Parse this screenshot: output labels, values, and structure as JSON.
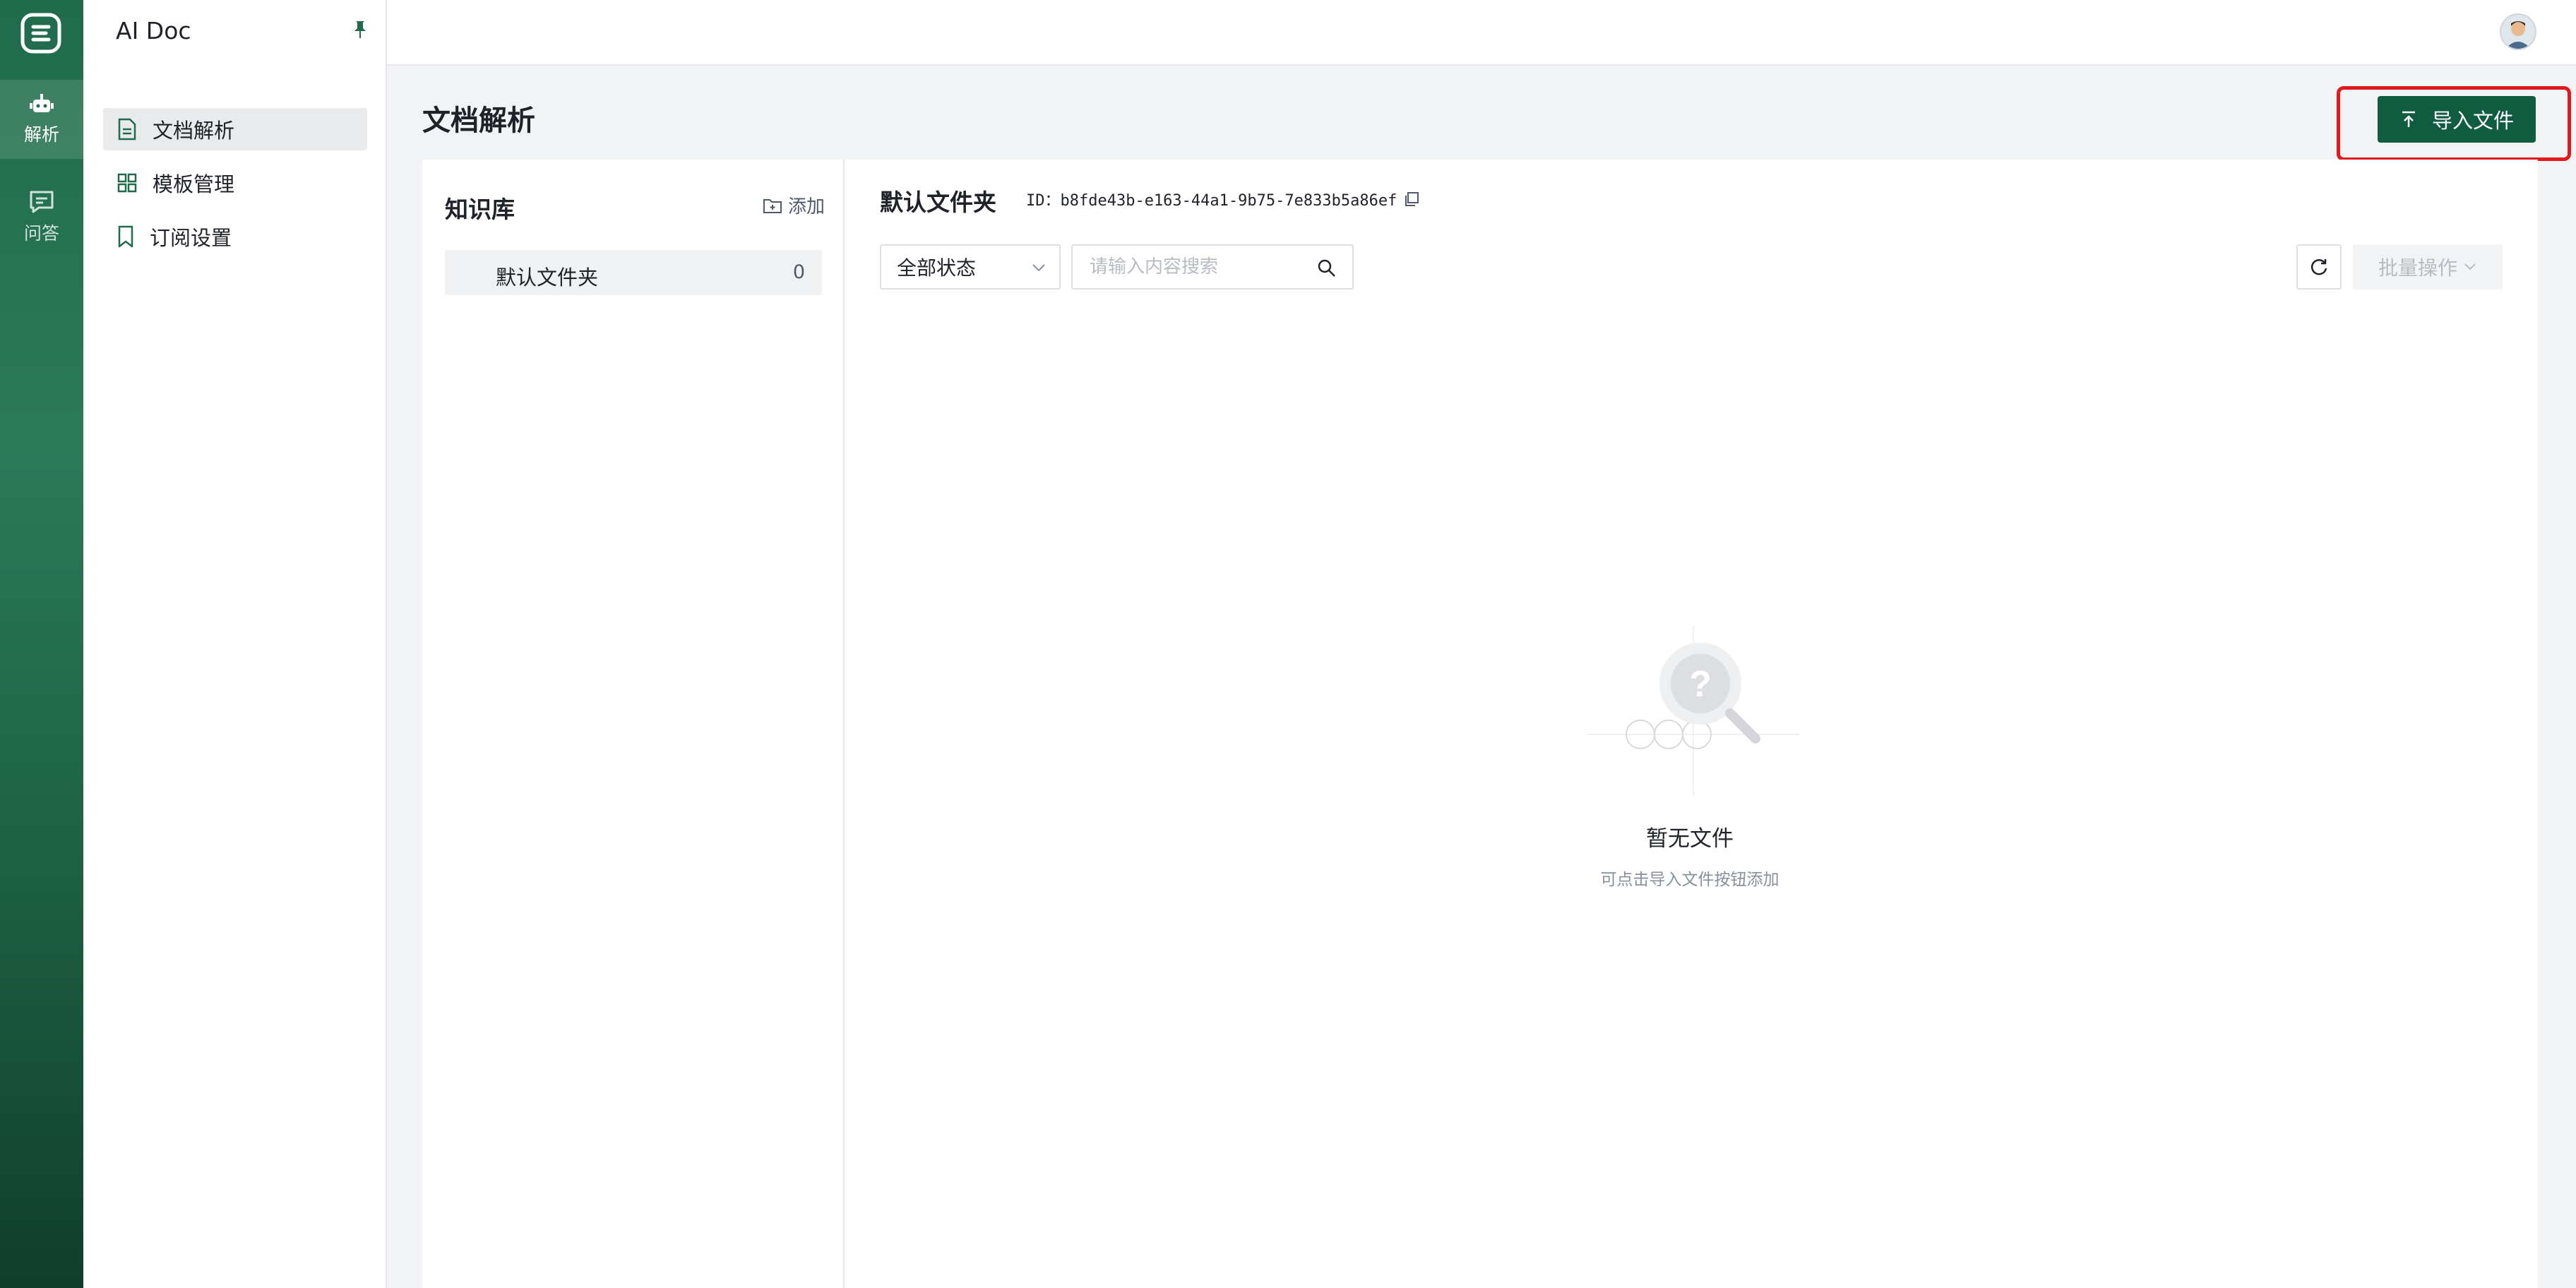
{
  "app": {
    "title": "AI Doc"
  },
  "rail": {
    "items": [
      {
        "label": "解析",
        "icon": "robot-icon",
        "active": true
      },
      {
        "label": "问答",
        "icon": "chat-icon",
        "active": false
      }
    ]
  },
  "sidebar": {
    "items": [
      {
        "label": "文档解析",
        "icon": "document-icon",
        "active": true
      },
      {
        "label": "模板管理",
        "icon": "grid-icon",
        "active": false
      },
      {
        "label": "订阅设置",
        "icon": "bookmark-icon",
        "active": false
      }
    ]
  },
  "page": {
    "title": "文档解析",
    "import_label": "导入文件"
  },
  "knowledge_base": {
    "title": "知识库",
    "add_label": "添加",
    "folders": [
      {
        "name": "默认文件夹",
        "count": "0"
      }
    ]
  },
  "folder": {
    "title": "默认文件夹",
    "id_text": "ID：b8fde43b-e163-44a1-9b75-7e833b5a86ef"
  },
  "toolbar": {
    "status_value": "全部状态",
    "search_placeholder": "请输入内容搜索",
    "batch_label": "批量操作"
  },
  "empty": {
    "title": "暂无文件",
    "subtitle": "可点击导入文件按钮添加"
  },
  "colors": {
    "brand": "#0f5c40",
    "highlight": "#e0191f"
  }
}
